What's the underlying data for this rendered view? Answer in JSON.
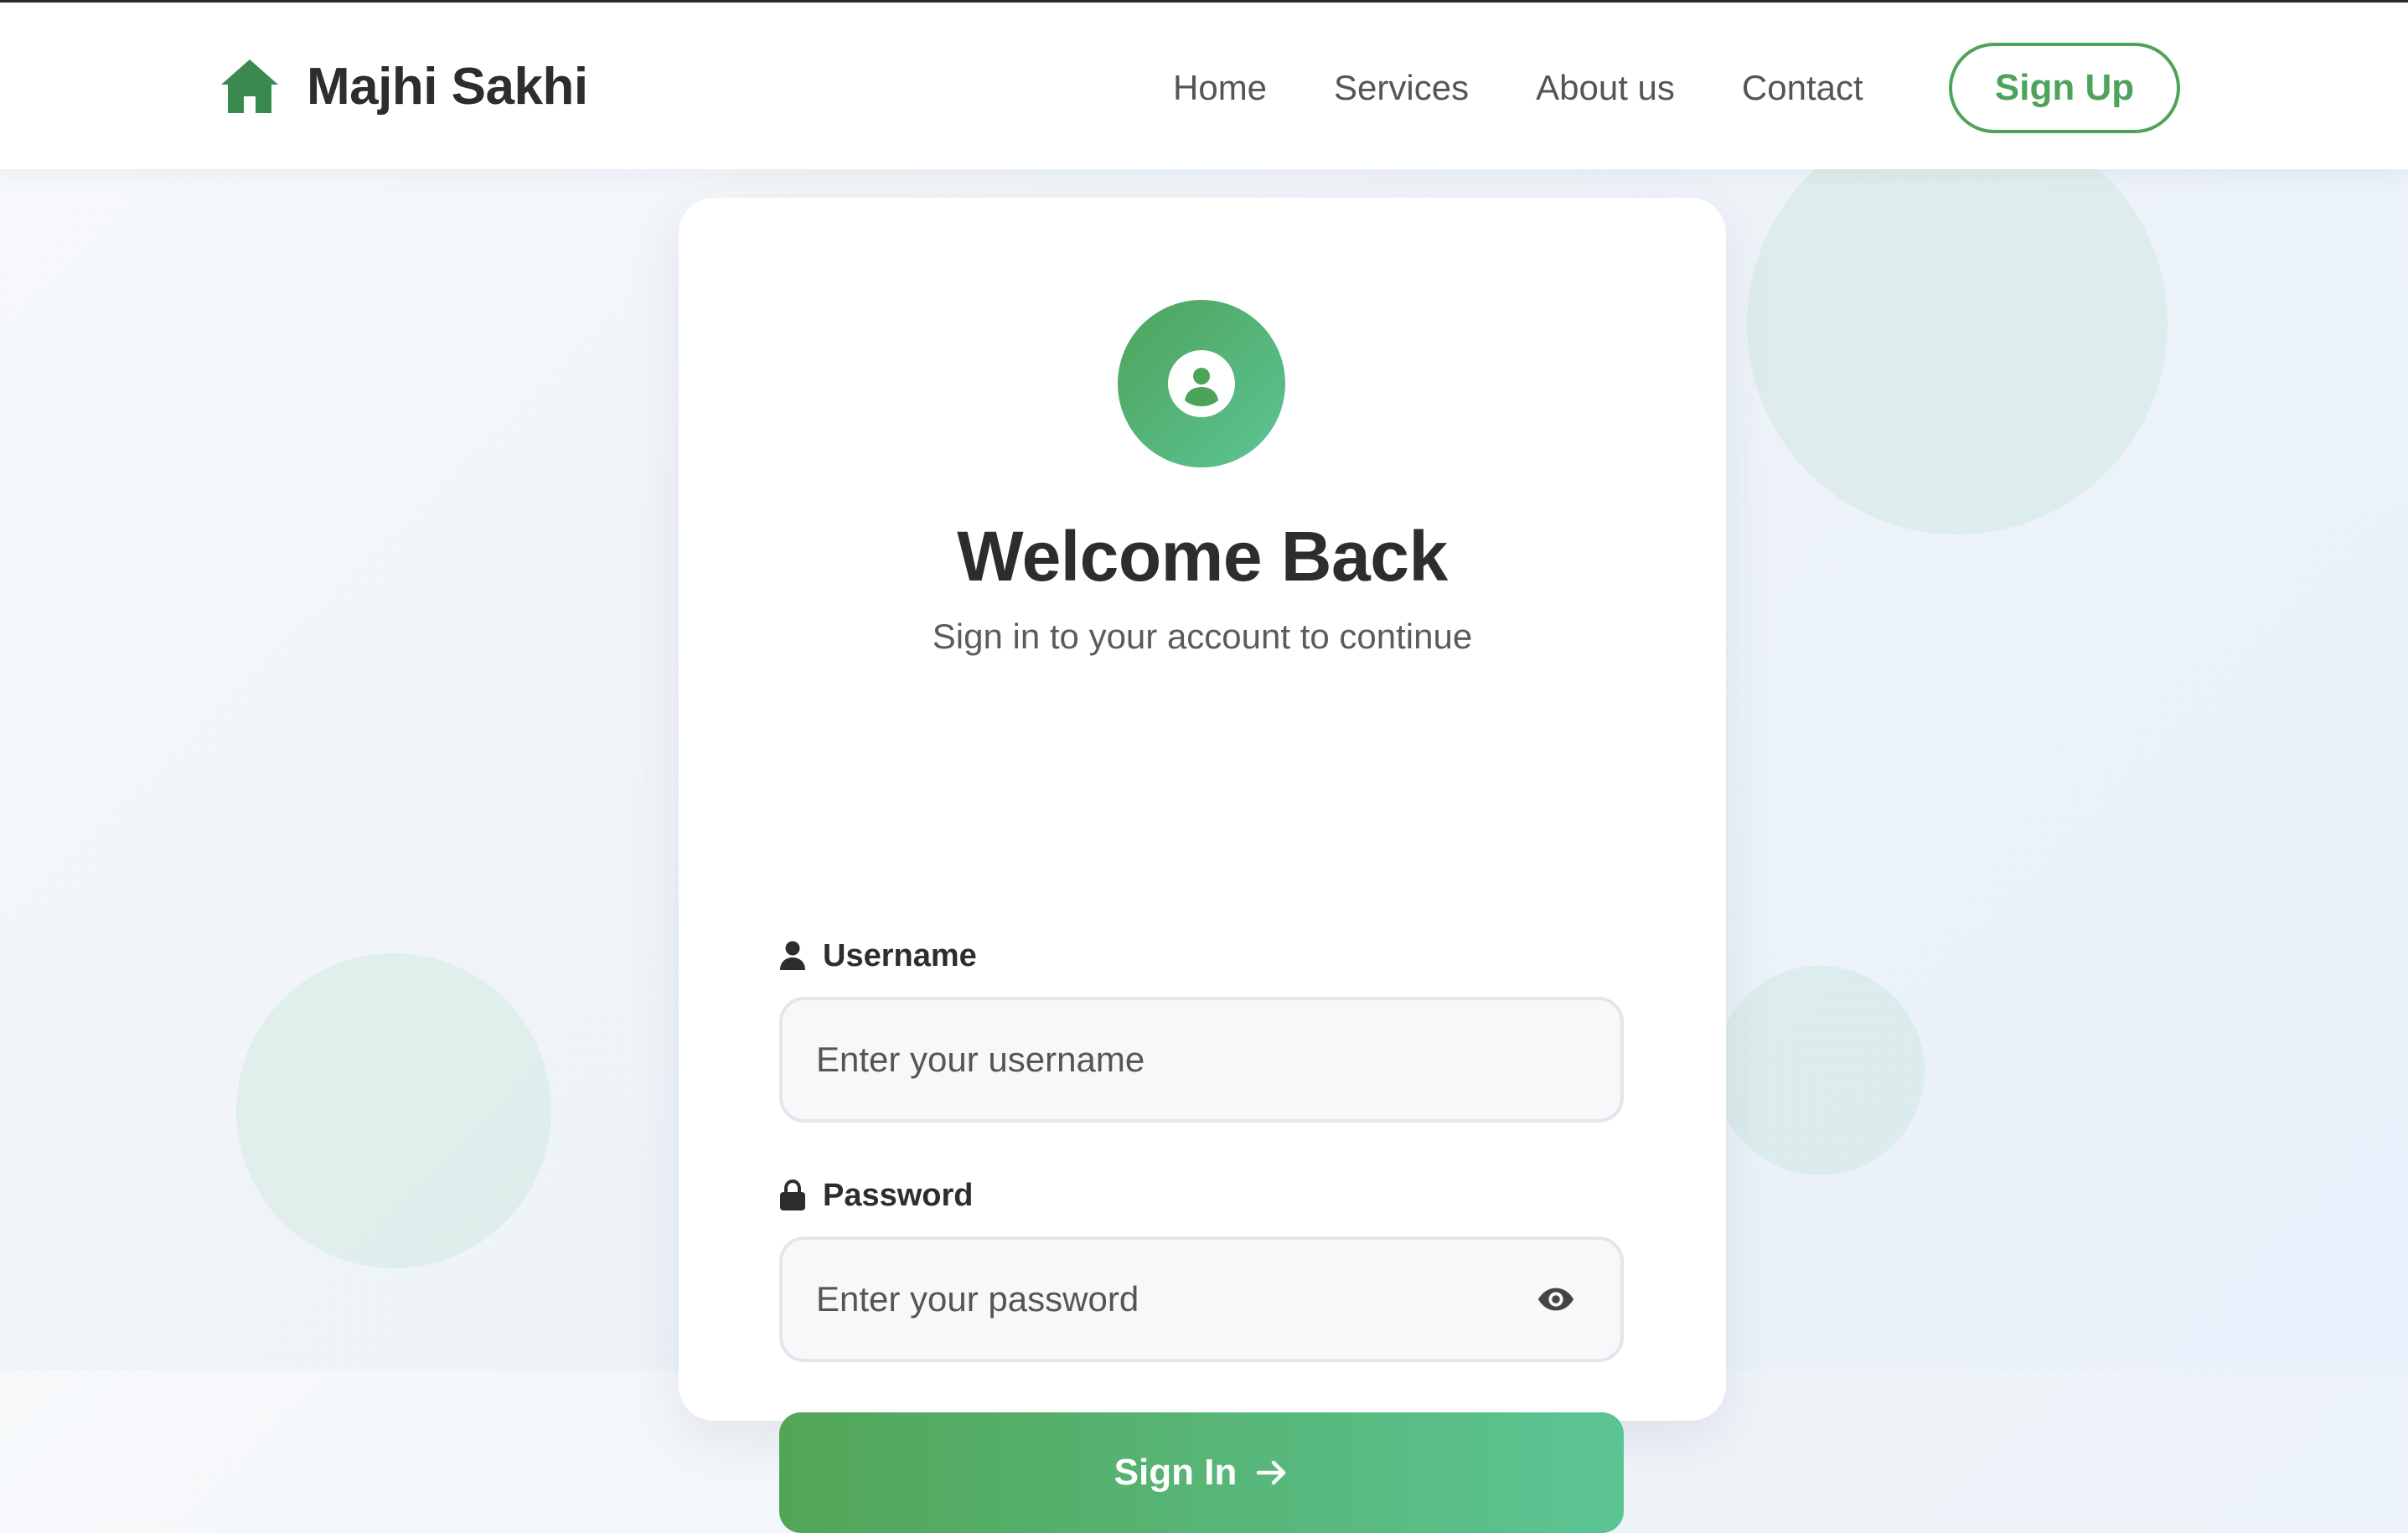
{
  "brand": {
    "name": "Majhi Sakhi",
    "icon": "home-icon",
    "icon_color": "#3a8a4f"
  },
  "nav": {
    "links": [
      {
        "label": "Home"
      },
      {
        "label": "Services"
      },
      {
        "label": "About us"
      },
      {
        "label": "Contact"
      }
    ],
    "signup_label": "Sign Up"
  },
  "login": {
    "avatar_icon": "user-circle-icon",
    "title": "Welcome Back",
    "subtitle": "Sign in to your account to continue",
    "username": {
      "label": "Username",
      "icon": "user-icon",
      "placeholder": "Enter your username",
      "value": ""
    },
    "password": {
      "label": "Password",
      "icon": "lock-icon",
      "placeholder": "Enter your password",
      "value": "",
      "toggle_icon": "eye-icon"
    },
    "submit_label": "Sign In",
    "submit_icon": "arrow-right-icon"
  },
  "colors": {
    "accent_green": "#4ea35b",
    "gradient_end": "#5cc595",
    "text_dark": "#2d2d2d",
    "text_muted": "#5b5b5b"
  }
}
